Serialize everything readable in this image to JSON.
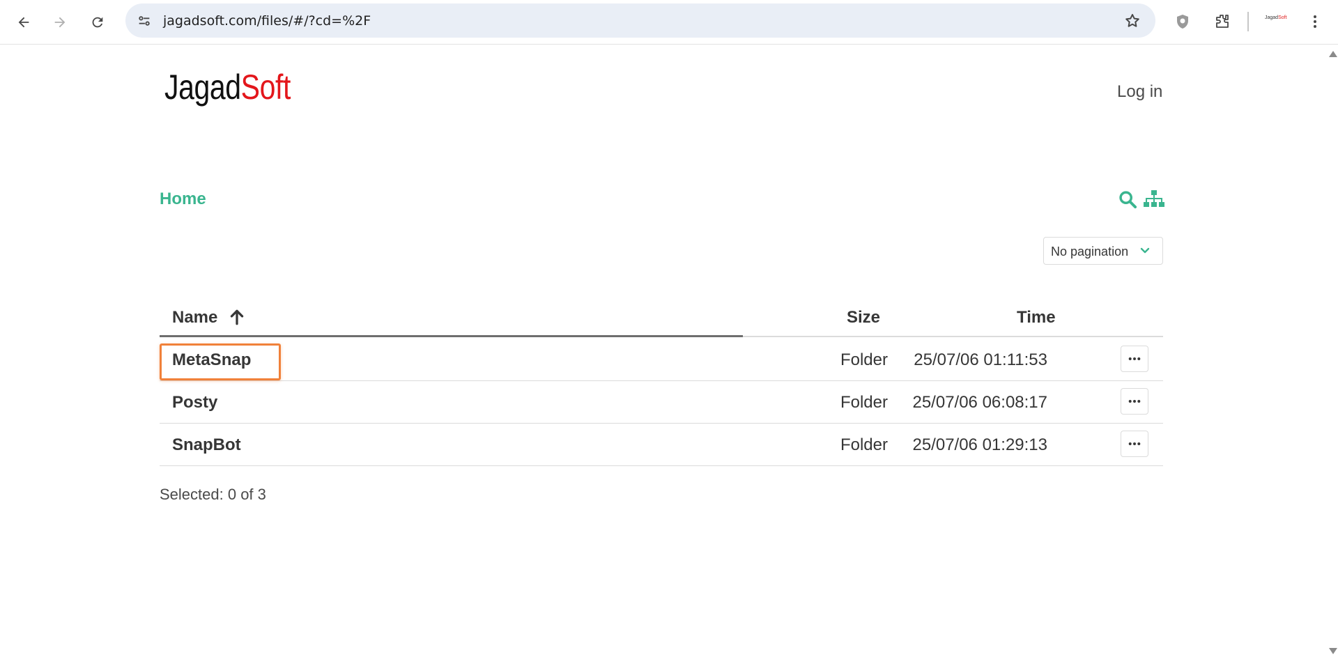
{
  "browser": {
    "url": "jagadsoft.com/files/#/?cd=%2F",
    "profile_label_left": "Jagad",
    "profile_label_right": "Soft"
  },
  "header": {
    "logo_left": "Jagad",
    "logo_right": "Soft",
    "login_label": "Log in"
  },
  "breadcrumb": {
    "home_label": "Home"
  },
  "pagination": {
    "selected": "No pagination"
  },
  "table": {
    "columns": {
      "name": "Name",
      "size": "Size",
      "time": "Time"
    },
    "rows": [
      {
        "name": "MetaSnap",
        "size": "Folder",
        "time": "25/07/06 01:11:53"
      },
      {
        "name": "Posty",
        "size": "Folder",
        "time": "25/07/06 06:08:17"
      },
      {
        "name": "SnapBot",
        "size": "Folder",
        "time": "25/07/06 01:29:13"
      }
    ]
  },
  "status": {
    "selected_text": "Selected: 0 of 3"
  },
  "colors": {
    "accent": "#3ab58f",
    "logo_red": "#e3161b",
    "highlight": "#f0813a"
  }
}
